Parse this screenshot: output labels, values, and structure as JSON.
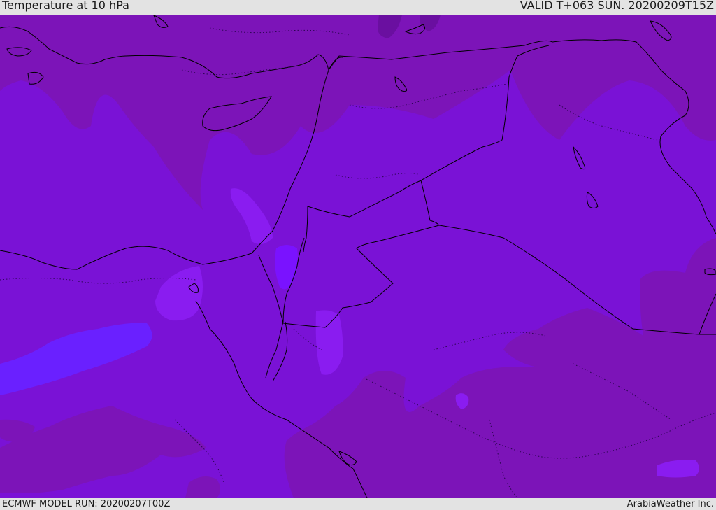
{
  "header": {
    "title": "Temperature at 10 hPa",
    "valid": "VALID T+063 SUN. 20200209T15Z"
  },
  "footer": {
    "model_run": "ECMWF MODEL RUN: 20200207T00Z",
    "credit": "ArabiaWeather Inc."
  },
  "colors": {
    "base_fill": "#7a12d6",
    "warm_fill": "#7c14b8",
    "darker_fill": "#6a0fa0",
    "cool_fill": "#8a1cf0",
    "coolest_fill": "#6a20ff",
    "coast_line": "#000000",
    "border_line": "#000000",
    "header_bg": "#e3e3e3"
  }
}
